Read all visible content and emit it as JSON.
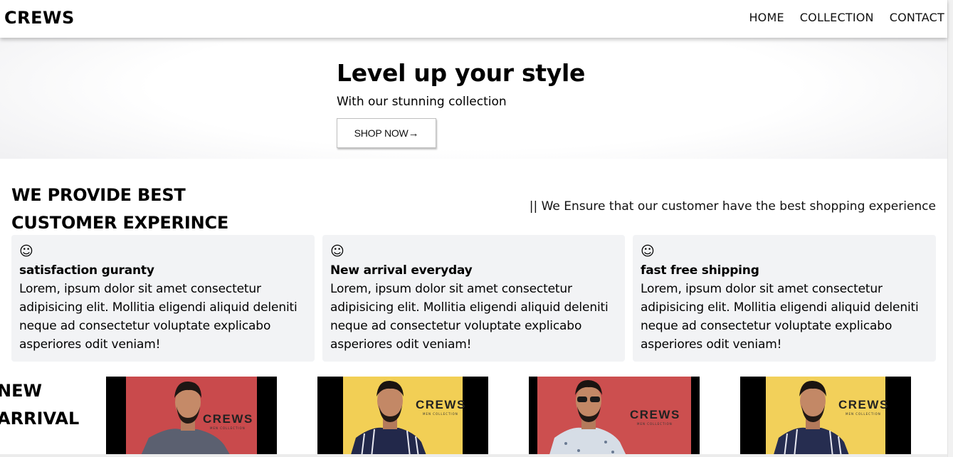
{
  "nav": {
    "brand": "CREWS",
    "links": [
      "HOME",
      "COLLECTION",
      "CONTACT"
    ]
  },
  "hero": {
    "title": "Level up your style",
    "subtitle": "With our stunning collection",
    "cta_label": "SHOP NOW",
    "cta_icon": "arrow-right-icon"
  },
  "features": {
    "title_line1": "WE PROVIDE BEST",
    "title_line2": "CUSTOMER EXPERINCE",
    "tagline": "|| We Ensure that our customer have the best shopping experience",
    "cards": [
      {
        "icon": "smile-icon",
        "title": "satisfaction guranty",
        "text": "Lorem, ipsum dolor sit amet consectetur adipisicing elit. Mollitia eligendi aliquid deleniti neque ad consectetur voluptate explicabo asperiores odit veniam!"
      },
      {
        "icon": "smile-icon",
        "title": "New arrival everyday",
        "text": "Lorem, ipsum dolor sit amet consectetur adipisicing elit. Mollitia eligendi aliquid deleniti neque ad consectetur voluptate explicabo asperiores odit veniam!"
      },
      {
        "icon": "smile-icon",
        "title": "fast free shipping",
        "text": "Lorem, ipsum dolor sit amet consectetur adipisicing elit. Mollitia eligendi aliquid deleniti neque ad consectetur voluptate explicabo asperiores odit veniam!"
      }
    ]
  },
  "new_arrival": {
    "title_line1": "NEW",
    "title_line2": "ARRIVAL",
    "products": [
      {
        "backdrop": "#c94a4c",
        "shirt": "#5b6070",
        "logo": "CREWS",
        "logo_sub": "MEN COLLECTION"
      },
      {
        "backdrop": "#f2cf55",
        "shirt": "#22284a",
        "logo": "CREWS",
        "logo_sub": "MEN COLLECTION"
      },
      {
        "backdrop": "#cc4f4f",
        "shirt": "#d6dde6",
        "logo": "CREWS",
        "logo_sub": "MEN COLLECTION"
      },
      {
        "backdrop": "#f2d05a",
        "shirt": "#262d50",
        "logo": "CREWS",
        "logo_sub": "MEN COLLECTION"
      }
    ]
  }
}
